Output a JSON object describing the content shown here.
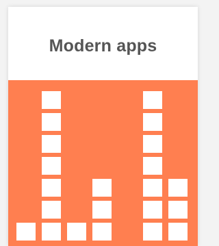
{
  "card": {
    "title": "Modern apps"
  },
  "colors": {
    "panel_bg": "#ff7f50",
    "block": "#ffffff",
    "title_text": "#555555"
  },
  "chart_data": {
    "type": "bar",
    "categories": [
      "",
      "",
      "",
      "",
      "",
      "",
      ""
    ],
    "values": [
      1,
      7,
      1,
      3,
      0,
      7,
      3
    ],
    "title": "",
    "xlabel": "",
    "ylabel": "",
    "ylim": [
      0,
      7
    ],
    "grid": false
  }
}
